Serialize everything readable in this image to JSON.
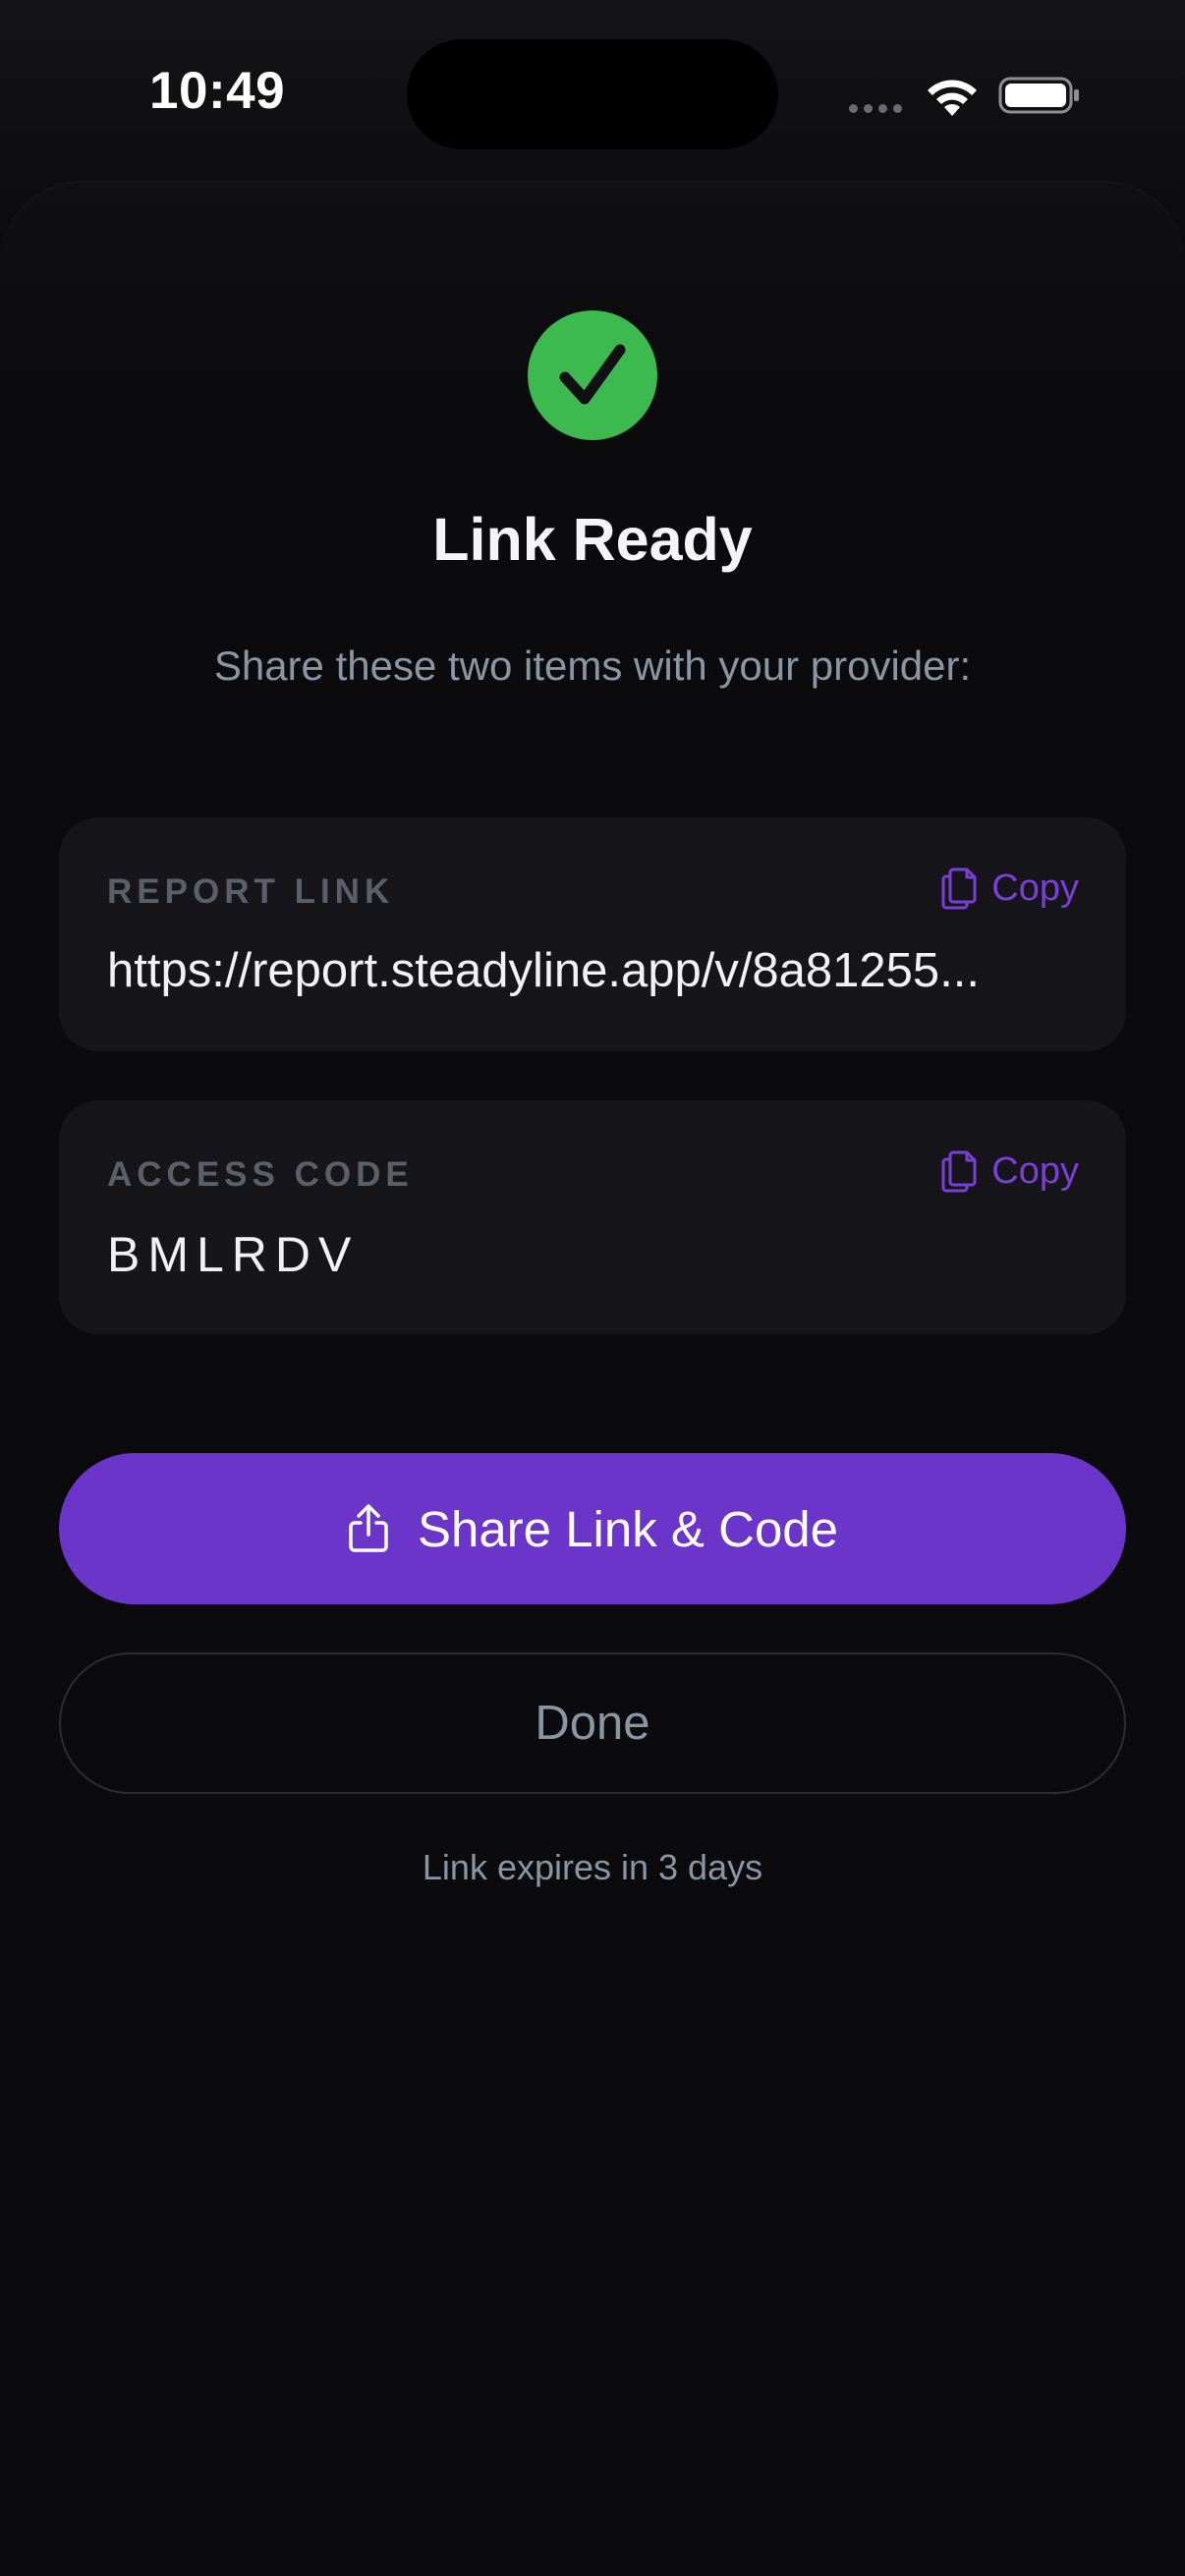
{
  "status_bar": {
    "time": "10:49"
  },
  "header": {
    "icon": "checkmark-circle-icon",
    "title": "Link Ready",
    "subtitle": "Share these two items with your provider:"
  },
  "report_link": {
    "label": "REPORT LINK",
    "value": "https://report.steadyline.app/v/8a81255...",
    "copy_label": "Copy",
    "copy_icon": "copy-icon"
  },
  "access_code": {
    "label": "ACCESS CODE",
    "value": "BMLRDV",
    "copy_label": "Copy",
    "copy_icon": "copy-icon"
  },
  "actions": {
    "share_label": "Share Link & Code",
    "share_icon": "share-icon",
    "done_label": "Done"
  },
  "footer": {
    "expiry_text": "Link expires in 3 days"
  },
  "colors": {
    "accent": "#6c35c9",
    "accent_text": "#7a3fd6",
    "success": "#3cb94f",
    "background": "#0b0b0e",
    "card": "#16161a",
    "muted_text": "#8a96a3"
  }
}
